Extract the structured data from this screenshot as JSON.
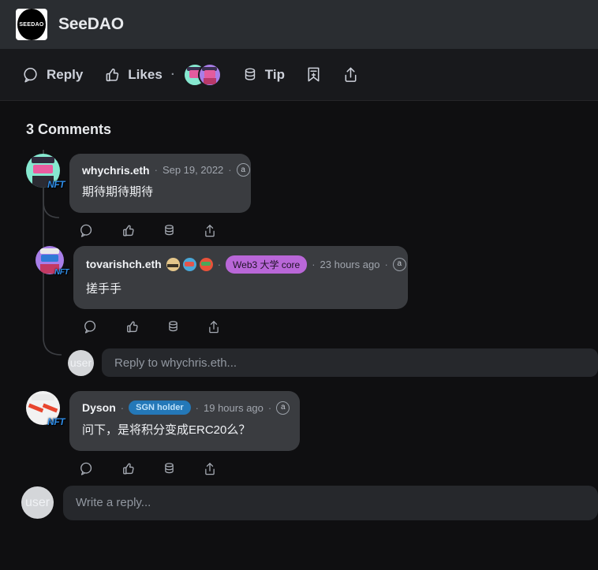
{
  "header": {
    "logo_text": "SEEDAO",
    "title": "SeeDAO"
  },
  "action_bar": {
    "reply_label": "Reply",
    "likes_label": "Likes",
    "likes_separator": "·",
    "tip_label": "Tip",
    "bookmark_icon": "bookmark-plus-icon",
    "share_icon": "share-icon",
    "like_avatar_count": 2
  },
  "comments": {
    "heading": "3 Comments",
    "items": [
      {
        "author": "whychris.eth",
        "sep1": "·",
        "timestamp": "Sep 19, 2022",
        "sep2": "·",
        "permanence_icon": "a",
        "text": "期待期待期待",
        "has_tag": false,
        "has_emoji_badges": false
      },
      {
        "author": "tovarishch.eth",
        "sep1": "·",
        "tag": "Web3 大学 core",
        "tag_color": "#b967d8",
        "sep2": "·",
        "timestamp": "23 hours ago",
        "sep3": "·",
        "permanence_icon": "a",
        "text": "搓手手",
        "has_tag": true,
        "has_emoji_badges": true
      },
      {
        "author": "Dyson",
        "sep1": "·",
        "tag": "SGN holder",
        "tag_color": "#2478b8",
        "sep2": "·",
        "timestamp": "19 hours ago",
        "sep3": "·",
        "permanence_icon": "a",
        "text": "问下，是将积分变成ERC20么？",
        "has_tag": true,
        "has_emoji_badges": false
      }
    ],
    "action_icons": [
      "reply-icon",
      "like-icon",
      "tip-icon",
      "share-icon"
    ],
    "nft_badge_label": "NFT"
  },
  "inline_reply": {
    "avatar_label": "user",
    "placeholder": "Reply to whychris.eth..."
  },
  "composer": {
    "avatar_label": "user",
    "placeholder": "Write a reply..."
  },
  "colors": {
    "page_bg": "#0f0f11",
    "header_bg": "#2a2d31",
    "bubble_bg": "#3a3c40",
    "input_bg": "#26282c",
    "purple_tag": "#b967d8",
    "blue_tag": "#2478b8",
    "nft_blue": "#2f8de8"
  }
}
